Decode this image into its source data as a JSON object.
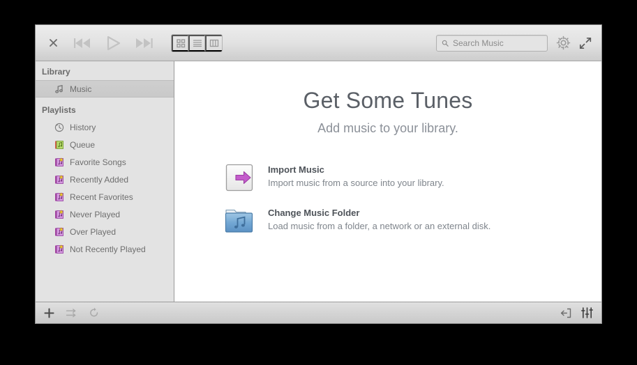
{
  "window": {
    "title": "Music Player"
  },
  "toolbar": {
    "close_label": "Close",
    "previous_label": "Previous",
    "play_label": "Play",
    "next_label": "Next",
    "view_grid_label": "Grid View",
    "view_list_label": "List View",
    "view_column_label": "Column View",
    "search_placeholder": "Search Music",
    "search_value": "",
    "settings_label": "Settings",
    "fullscreen_label": "Fullscreen"
  },
  "sidebar": {
    "library_header": "Library",
    "library_items": [
      {
        "label": "Music",
        "icon": "music-note-icon",
        "selected": true
      }
    ],
    "playlists_header": "Playlists",
    "playlist_items": [
      {
        "label": "History",
        "icon": "clock-icon"
      },
      {
        "label": "Queue",
        "icon": "queue-icon"
      },
      {
        "label": "Favorite Songs",
        "icon": "smart-playlist-icon"
      },
      {
        "label": "Recently Added",
        "icon": "smart-playlist-icon"
      },
      {
        "label": "Recent Favorites",
        "icon": "smart-playlist-icon"
      },
      {
        "label": "Never Played",
        "icon": "smart-playlist-icon"
      },
      {
        "label": "Over Played",
        "icon": "smart-playlist-icon"
      },
      {
        "label": "Not Recently Played",
        "icon": "smart-playlist-icon"
      }
    ]
  },
  "main": {
    "title": "Get Some Tunes",
    "subtitle": "Add music to your library.",
    "actions": [
      {
        "title": "Import Music",
        "description": "Import music from a source into your library.",
        "icon": "import-arrow-icon"
      },
      {
        "title": "Change Music Folder",
        "description": "Load music from a folder, a network or an external disk.",
        "icon": "music-folder-icon"
      }
    ]
  },
  "bottombar": {
    "add_label": "Add Playlist",
    "shuffle_label": "Shuffle",
    "repeat_label": "Repeat",
    "export_label": "Export",
    "equalizer_label": "Equalizer"
  },
  "colors": {
    "accent_magenta": "#c057c9",
    "folder_blue": "#5b9bd0",
    "window_chrome": "#e2e2e2",
    "sidebar_bg": "#e3e3e3",
    "text_muted": "#7f858c",
    "title_text": "#5a5f66"
  }
}
